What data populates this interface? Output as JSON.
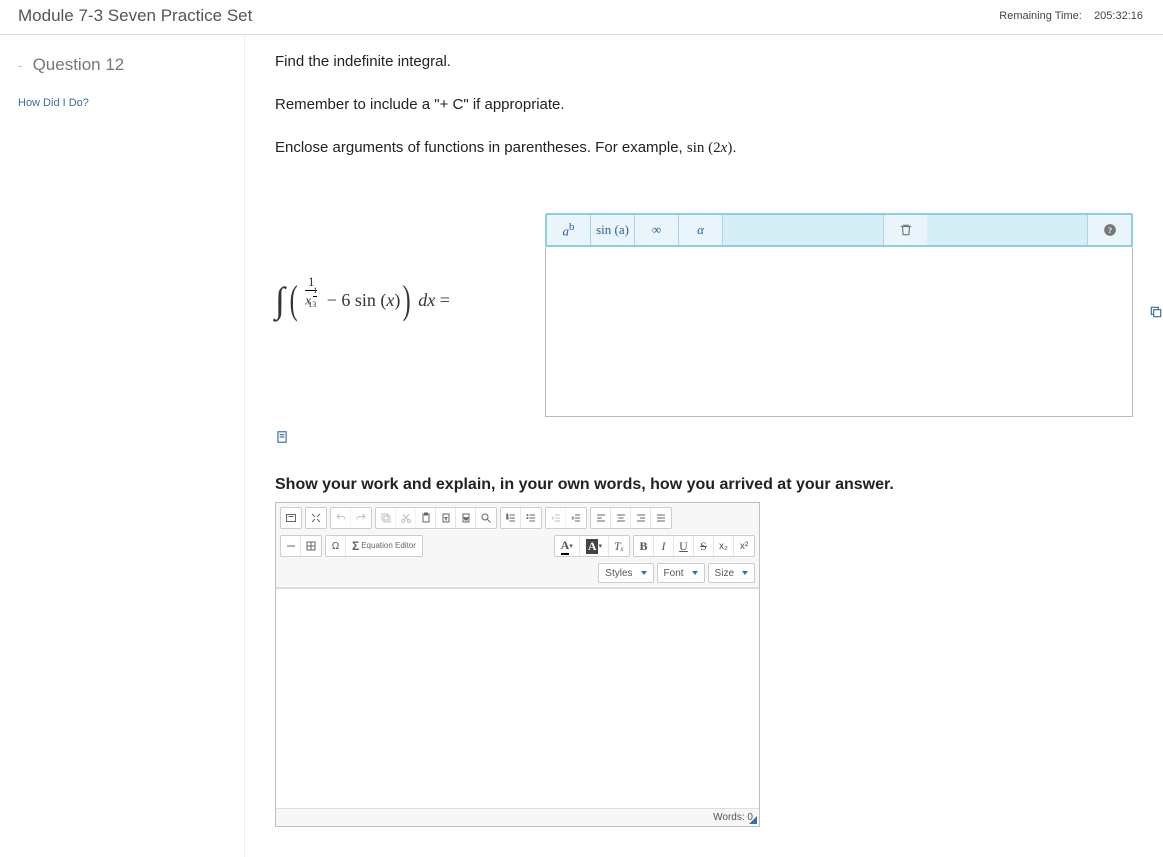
{
  "header": {
    "title": "Module 7-3 Seven Practice Set",
    "time_label": "Remaining Time:",
    "time_value": "205:32:16"
  },
  "sidebar": {
    "question_label": "Question 12",
    "how_link": "How Did I Do?"
  },
  "prompt": {
    "line1": "Find the indefinite integral.",
    "line2_a": "Remember to include a \"+ C\" if appropriate.",
    "line3_a": "Enclose arguments of functions in parentheses. For example, ",
    "line3_math": "sin (2x)",
    "line3_b": "."
  },
  "equation": {
    "frac_num": "1",
    "frac_den_base": "x",
    "frac_den_exp": "13",
    "minus": " − ",
    "term2": "6 sin (x)",
    "dx": " dx =",
    "frac_den_exp_display": "13"
  },
  "eq_toolbar": {
    "b1": "a",
    "b1_sup": "b",
    "b2": "sin (a)",
    "b3": "∞",
    "b4": "α"
  },
  "show_work": "Show your work and explain, in your own words, how you arrived at your answer.",
  "rte": {
    "equation_editor": "Equation\nEditor",
    "styles": "Styles",
    "font": "Font",
    "size": "Size",
    "words_label": "Words: 0",
    "A": "A",
    "B": "B",
    "I": "I",
    "U": "U",
    "S": "S",
    "sub": "x₂",
    "sup": "x²",
    "Tx": "Tₓ",
    "omega": "Ω",
    "sigma": "Σ"
  }
}
